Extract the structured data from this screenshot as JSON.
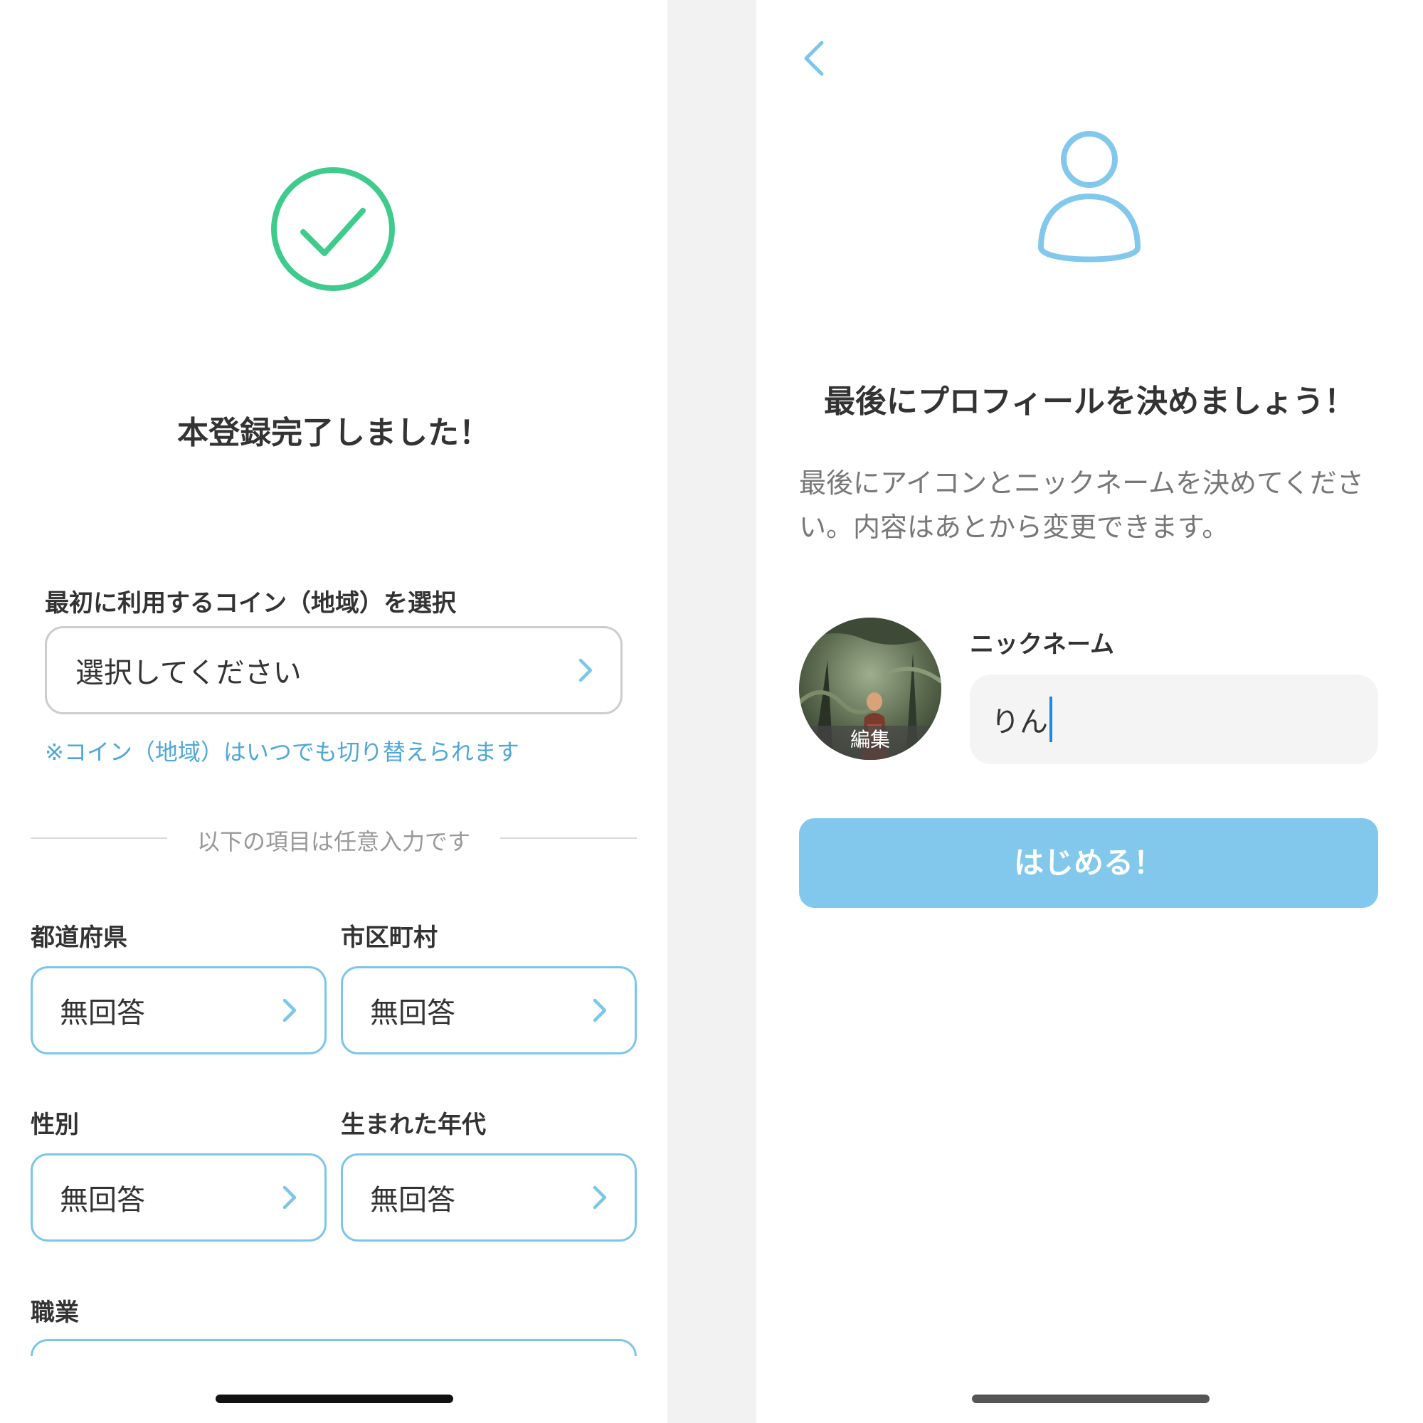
{
  "left_screen": {
    "title": "本登録完了しました！",
    "coin_section": {
      "label": "最初に利用するコイン（地域）を選択",
      "select_placeholder": "選択してください",
      "note": "※コイン（地域）はいつでも切り替えられます"
    },
    "divider_text": "以下の項目は任意入力です",
    "fields": {
      "prefecture": {
        "label": "都道府県",
        "value": "無回答"
      },
      "city": {
        "label": "市区町村",
        "value": "無回答"
      },
      "gender": {
        "label": "性別",
        "value": "無回答"
      },
      "birth_era": {
        "label": "生まれた年代",
        "value": "無回答"
      },
      "occupation": {
        "label": "職業"
      }
    }
  },
  "right_screen": {
    "title": "最後にプロフィールを決めましょう！",
    "description": "最後にアイコンとニックネームを決めてください。内容はあとから変更できます。",
    "avatar_edit_label": "編集",
    "nickname": {
      "label": "ニックネーム",
      "value": "りん"
    },
    "start_button": "はじめる！"
  },
  "icons": {
    "success": "check-circle-icon",
    "select_arrow": "chevron-right-icon",
    "back": "chevron-left-icon",
    "profile": "person-icon"
  },
  "colors": {
    "success_green": "#3ecb8b",
    "accent_blue": "#7cc6ea",
    "link_blue": "#4fa7d6",
    "button_blue": "#82c8ed",
    "text_dark": "#333333",
    "text_gray": "#777777"
  }
}
